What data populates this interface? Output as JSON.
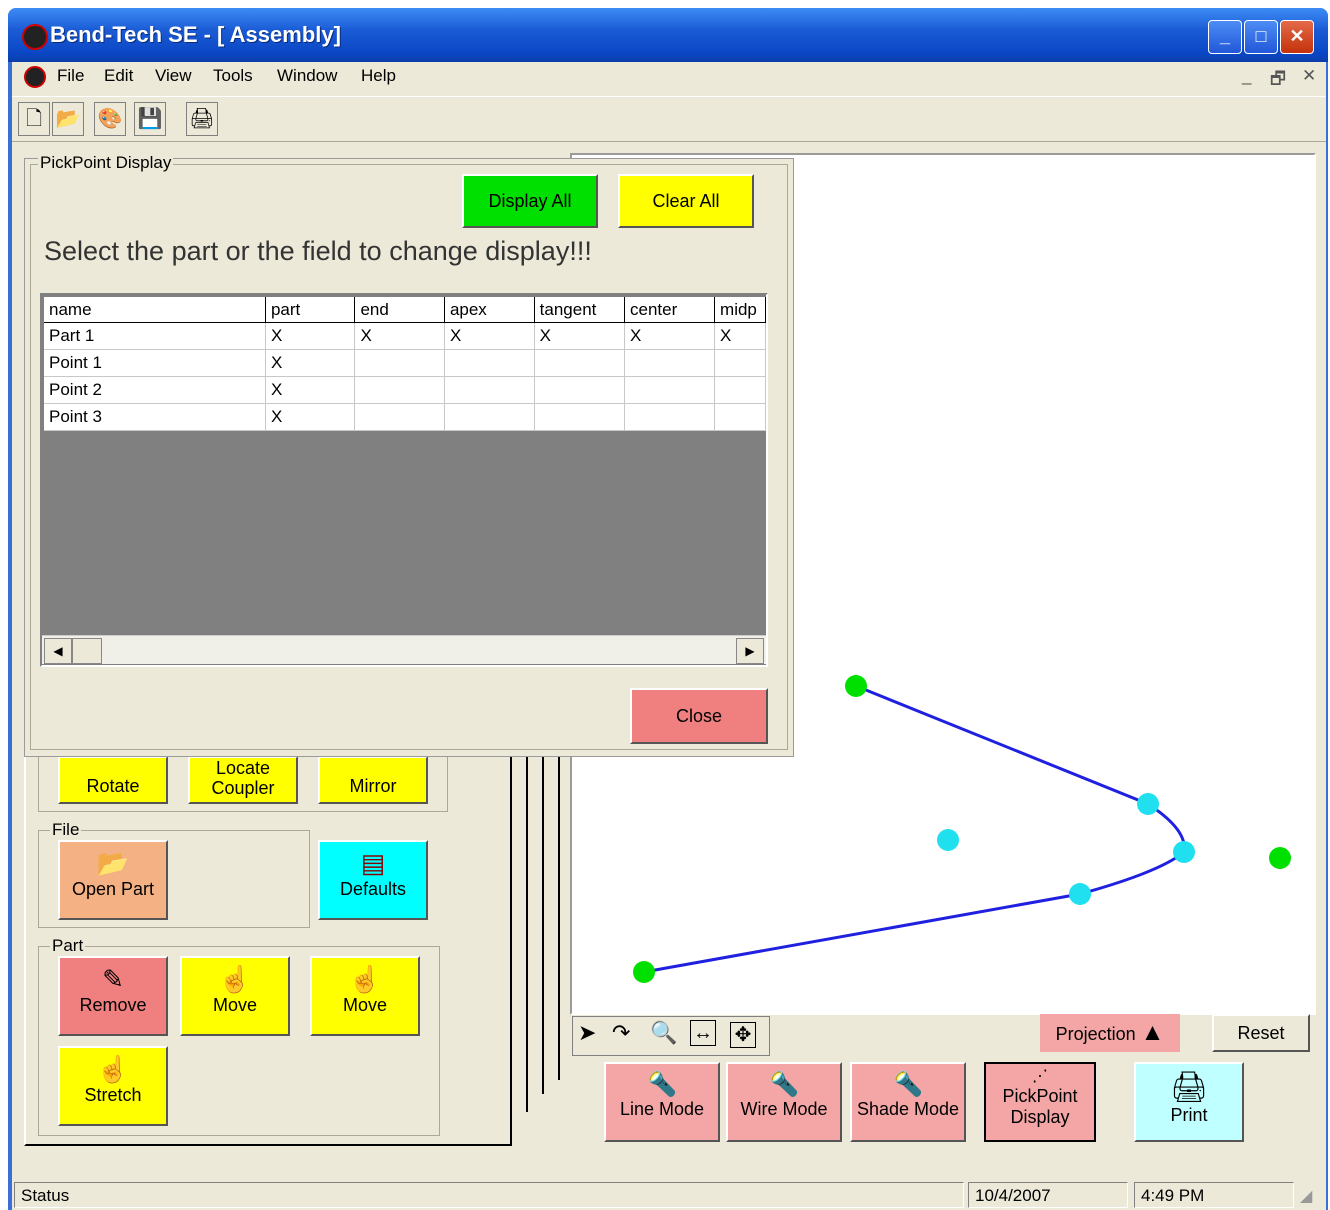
{
  "window": {
    "title": "Bend-Tech SE - [ Assembly]"
  },
  "menu": [
    "File",
    "Edit",
    "View",
    "Tools",
    "Window",
    "Help"
  ],
  "toolbar": [
    "new-icon",
    "open-icon",
    "color-icon",
    "save-icon",
    "print-icon"
  ],
  "dialog": {
    "group_label": "PickPoint Display",
    "display_all": "Display All",
    "clear_all": "Clear All",
    "instruction": "Select the part or the field to change display!!!",
    "close": "Close",
    "columns": [
      "name",
      "part",
      "end",
      "apex",
      "tangent",
      "center",
      "midp"
    ],
    "rows": [
      [
        "Part 1",
        "X",
        "X",
        "X",
        "X",
        "X",
        "X"
      ],
      [
        "Point 1",
        "X",
        "",
        "",
        "",
        "",
        ""
      ],
      [
        "Point 2",
        "X",
        "",
        "",
        "",
        "",
        ""
      ],
      [
        "Point 3",
        "X",
        "",
        "",
        "",
        "",
        ""
      ]
    ]
  },
  "left_panel": {
    "rotate": "Rotate",
    "locate_coupler_1": "Locate",
    "locate_coupler_2": "Coupler",
    "mirror": "Mirror",
    "file_label": "File",
    "open_part": "Open Part",
    "defaults": "Defaults",
    "part_label": "Part",
    "remove": "Remove",
    "move1": "Move",
    "move2": "Move",
    "stretch": "Stretch"
  },
  "view_controls": {
    "projection": "Projection",
    "reset": "Reset",
    "line_mode": "Line Mode",
    "wire_mode": "Wire Mode",
    "shade_mode": "Shade Mode",
    "pickpoint_1": "PickPoint",
    "pickpoint_2": "Display",
    "print": "Print"
  },
  "status": {
    "text": "Status",
    "date": "10/4/2007",
    "time": "4:49 PM"
  },
  "colors": {
    "green": "#00e000",
    "yellow": "#ffff00",
    "pink": "#f08080",
    "cyan": "#00ffff",
    "orange": "#f4b183",
    "accent_blue": "#0a46c4"
  }
}
